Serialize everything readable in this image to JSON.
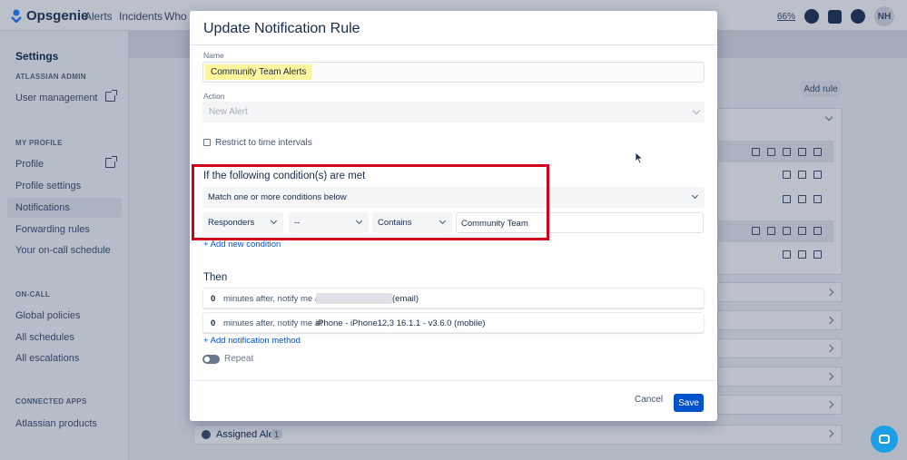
{
  "topnav": {
    "brand": "Opsgenie",
    "items": [
      "Alerts",
      "Incidents",
      "Who is"
    ],
    "zoom": "66%",
    "avatar": "NH"
  },
  "sidebar": {
    "title": "Settings",
    "sections": [
      {
        "label": "ATLASSIAN ADMIN",
        "items": [
          "User management"
        ]
      },
      {
        "label": "MY PROFILE",
        "items": [
          "Profile",
          "Profile settings",
          "Notifications",
          "Forwarding rules",
          "Your on-call schedule"
        ]
      },
      {
        "label": "ON-CALL",
        "items": [
          "Global policies",
          "All schedules",
          "All escalations"
        ]
      },
      {
        "label": "CONNECTED APPS",
        "items": [
          "Atlassian products"
        ]
      }
    ],
    "active": "Notifications"
  },
  "background": {
    "add_rule": "Add rule",
    "assigned_alert": "Assigned Alert",
    "assigned_count": "1"
  },
  "modal": {
    "title": "Update Notification Rule",
    "name_label": "Name",
    "name_value": "Community Team Alerts",
    "action_label": "Action",
    "action_value": "New Alert",
    "restrict_label": "Restrict to time intervals",
    "conditions_heading": "If the following condition(s) are met",
    "match_value": "Match one or more conditions below",
    "condition": {
      "field": "Responders",
      "sub": "--",
      "operator": "Contains",
      "value": "Community Team"
    },
    "add_condition": "+ Add new condition",
    "then_heading": "Then",
    "notify_rows": [
      {
        "minutes": "0",
        "text": "minutes after, notify me at",
        "method": "(email)"
      },
      {
        "minutes": "0",
        "text": "minutes after, notify me at",
        "method": "iPhone - iPhone12,3 16.1.1 - v3.6.0 (mobile)"
      }
    ],
    "add_method": "+ Add notification method",
    "repeat_label": "Repeat",
    "cancel": "Cancel",
    "save": "Save"
  },
  "colors": {
    "primary": "#0052cc",
    "highlight_box": "#d0021b",
    "name_highlight": "#fff59d"
  }
}
